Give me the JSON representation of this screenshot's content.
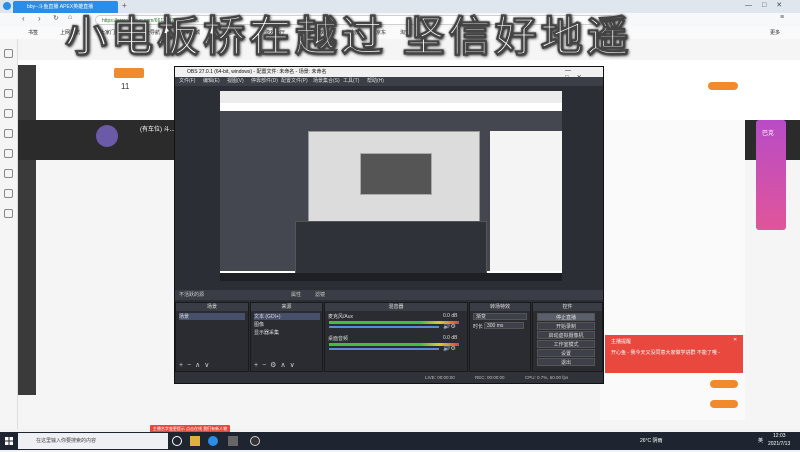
{
  "browser": {
    "tab_title": "bby--斗鱼直播 APEX英雄直播",
    "url": "https://www.douyu.com/6612317/2318000...",
    "bookmarks": [
      "书签",
      "上网导航",
      "大家门...",
      "网址导航",
      "京东商城",
      "天猫商城",
      "游戏大厅",
      "网页游戏",
      "聚划算",
      "京东",
      "淘宝",
      "更多"
    ]
  },
  "overlay_text": "小电板桥在越过  坚信好地遥",
  "page": {
    "streamer_label": "(有车位) 斗...",
    "follow_count": "11",
    "right_banner": "巴克"
  },
  "obs": {
    "title": "OBS 27.0.1 (64-bit, windows) - 配置文件: 未命名 - 场景: 未命名",
    "menu": [
      "文件(F)",
      "编辑(E)",
      "视图(V)",
      "停靠部件(D)",
      "配置文件(P)",
      "场景集合(S)",
      "工具(T)",
      "帮助(H)"
    ],
    "source_header": "不活跃的源",
    "filters_label": "属性",
    "filters_label2": "滤镜",
    "docks": {
      "scenes": {
        "title": "场景",
        "items": [
          "场景"
        ]
      },
      "sources": {
        "title": "来源",
        "items": [
          "文本 (GDI+)",
          "图像",
          "显示器采集"
        ]
      },
      "mixer": {
        "title": "混音器",
        "channels": [
          {
            "name": "麦克风/Aux",
            "db": "0.0 dB"
          },
          {
            "name": "桌面音频",
            "db": "0.0 dB"
          }
        ]
      },
      "transitions": {
        "title": "转场特效",
        "type": "渐变",
        "duration_label": "时长",
        "duration": "300 ms"
      },
      "controls": {
        "title": "控件",
        "buttons": [
          "停止直播",
          "开始录制",
          "启动虚拟摄像机",
          "工作室模式",
          "设置",
          "退出"
        ]
      }
    },
    "status": {
      "live": "LIVE: 00:00:00",
      "rec": "REC: 00:00:00",
      "cpu": "CPU: 0.7%, 60.00 fps"
    }
  },
  "popup": {
    "title": "主播提醒",
    "text": "开心鱼 - 我今天又没同意大家做学进群 不能了哦 -"
  },
  "promo_text": "主播名字变更提示 点击在线 我们有新人物",
  "taskbar": {
    "search_placeholder": "在这里输入你要搜索的内容",
    "weather": "26°C 阴雨",
    "time": "12:03",
    "date": "2021/7/13",
    "lang": "英"
  },
  "colors": {
    "brand": "#2a8de8",
    "obs_bg": "#2b2e35",
    "accent_orange": "#f08a2c",
    "alert_red": "#e8483e"
  }
}
